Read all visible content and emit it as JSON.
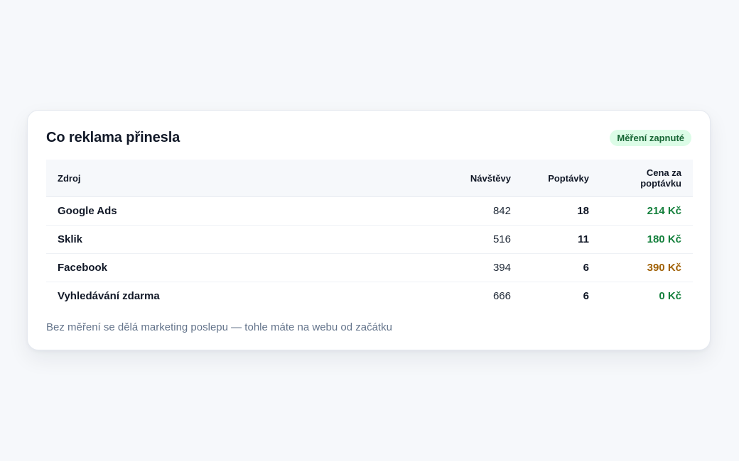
{
  "card": {
    "title": "Co reklama přinesla",
    "badge": "Měření zapnuté",
    "footnote": "Bez měření se dělá marketing poslepu — tohle máte na webu od začátku"
  },
  "table": {
    "headers": {
      "source": "Zdroj",
      "visits": "Návštěvy",
      "leads": "Poptávky",
      "cost_line1": "Cena za",
      "cost_line2": "poptávku"
    },
    "rows": [
      {
        "source": "Google Ads",
        "visits": "842",
        "leads": "18",
        "cost": "214 Kč",
        "cost_status": "good"
      },
      {
        "source": "Sklik",
        "visits": "516",
        "leads": "11",
        "cost": "180 Kč",
        "cost_status": "good"
      },
      {
        "source": "Facebook",
        "visits": "394",
        "leads": "6",
        "cost": "390 Kč",
        "cost_status": "warn"
      },
      {
        "source": "Vyhledávání zdarma",
        "visits": "666",
        "leads": "6",
        "cost": "0 Kč",
        "cost_status": "good"
      }
    ]
  },
  "colors": {
    "cost_good": "#15803d",
    "cost_warn": "#a16207",
    "badge_bg": "#dcfce7",
    "badge_text": "#166534"
  }
}
